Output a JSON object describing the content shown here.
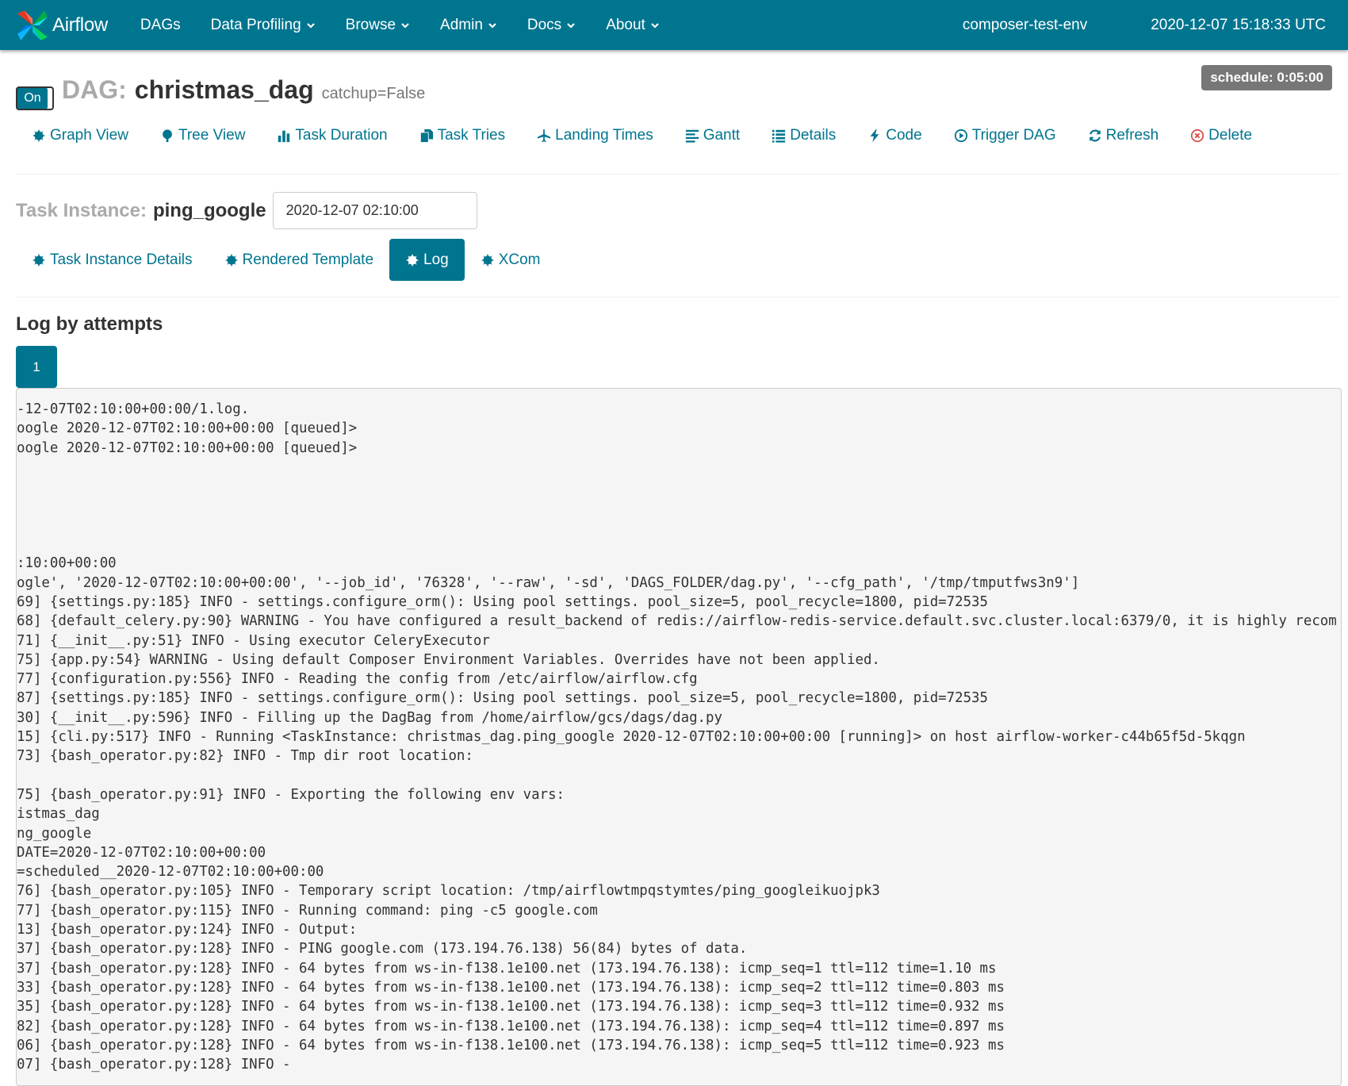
{
  "navbar": {
    "brand": "Airflow",
    "items": [
      {
        "label": "DAGs",
        "dropdown": false
      },
      {
        "label": "Data Profiling",
        "dropdown": true
      },
      {
        "label": "Browse",
        "dropdown": true
      },
      {
        "label": "Admin",
        "dropdown": true
      },
      {
        "label": "Docs",
        "dropdown": true
      },
      {
        "label": "About",
        "dropdown": true
      }
    ],
    "environment": "composer-test-env",
    "clock": "2020-12-07 15:18:33 UTC"
  },
  "dag": {
    "toggle_label": "On",
    "label": "DAG:",
    "name": "christmas_dag",
    "catchup": "catchup=False",
    "schedule": "schedule: 0:05:00"
  },
  "dag_nav": [
    {
      "label": "Graph View",
      "icon": "asterisk-icon"
    },
    {
      "label": "Tree View",
      "icon": "tree-icon"
    },
    {
      "label": "Task Duration",
      "icon": "bar-chart-icon"
    },
    {
      "label": "Task Tries",
      "icon": "duplicate-icon"
    },
    {
      "label": "Landing Times",
      "icon": "plane-icon"
    },
    {
      "label": "Gantt",
      "icon": "align-left-icon"
    },
    {
      "label": "Details",
      "icon": "list-icon"
    },
    {
      "label": "Code",
      "icon": "flash-icon"
    },
    {
      "label": "Trigger DAG",
      "icon": "play-circle-icon"
    },
    {
      "label": "Refresh",
      "icon": "refresh-icon"
    },
    {
      "label": "Delete",
      "icon": "remove-circle-icon"
    }
  ],
  "task_instance": {
    "label": "Task Instance:",
    "name": "ping_google",
    "execution_date": "2020-12-07 02:10:00"
  },
  "ti_tabs": [
    {
      "label": "Task Instance Details",
      "active": false
    },
    {
      "label": "Rendered Template",
      "active": false
    },
    {
      "label": "Log",
      "active": true
    },
    {
      "label": "XCom",
      "active": false
    }
  ],
  "log": {
    "title": "Log by attempts",
    "attempts": [
      "1"
    ],
    "lines": [
      "-12-07T02:10:00+00:00/1.log.",
      "oogle 2020-12-07T02:10:00+00:00 [queued]>",
      "oogle 2020-12-07T02:10:00+00:00 [queued]>",
      "",
      "",
      "",
      "",
      "",
      ":10:00+00:00",
      "ogle', '2020-12-07T02:10:00+00:00', '--job_id', '76328', '--raw', '-sd', 'DAGS_FOLDER/dag.py', '--cfg_path', '/tmp/tmputfws3n9']",
      "69] {settings.py:185} INFO - settings.configure_orm(): Using pool settings. pool_size=5, pool_recycle=1800, pid=72535",
      "68] {default_celery.py:90} WARNING - You have configured a result_backend of redis://airflow-redis-service.default.svc.cluster.local:6379/0, it is highly recom",
      "71] {__init__.py:51} INFO - Using executor CeleryExecutor",
      "75] {app.py:54} WARNING - Using default Composer Environment Variables. Overrides have not been applied.",
      "77] {configuration.py:556} INFO - Reading the config from /etc/airflow/airflow.cfg",
      "87] {settings.py:185} INFO - settings.configure_orm(): Using pool settings. pool_size=5, pool_recycle=1800, pid=72535",
      "30] {__init__.py:596} INFO - Filling up the DagBag from /home/airflow/gcs/dags/dag.py",
      "15] {cli.py:517} INFO - Running <TaskInstance: christmas_dag.ping_google 2020-12-07T02:10:00+00:00 [running]> on host airflow-worker-c44b65f5d-5kqgn",
      "73] {bash_operator.py:82} INFO - Tmp dir root location:",
      "",
      "75] {bash_operator.py:91} INFO - Exporting the following env vars:",
      "istmas_dag",
      "ng_google",
      "DATE=2020-12-07T02:10:00+00:00",
      "=scheduled__2020-12-07T02:10:00+00:00",
      "76] {bash_operator.py:105} INFO - Temporary script location: /tmp/airflowtmpqstymtes/ping_googleikuojpk3",
      "77] {bash_operator.py:115} INFO - Running command: ping -c5 google.com",
      "13] {bash_operator.py:124} INFO - Output:",
      "37] {bash_operator.py:128} INFO - PING google.com (173.194.76.138) 56(84) bytes of data.",
      "37] {bash_operator.py:128} INFO - 64 bytes from ws-in-f138.1e100.net (173.194.76.138): icmp_seq=1 ttl=112 time=1.10 ms",
      "33] {bash_operator.py:128} INFO - 64 bytes from ws-in-f138.1e100.net (173.194.76.138): icmp_seq=2 ttl=112 time=0.803 ms",
      "35] {bash_operator.py:128} INFO - 64 bytes from ws-in-f138.1e100.net (173.194.76.138): icmp_seq=3 ttl=112 time=0.932 ms",
      "82] {bash_operator.py:128} INFO - 64 bytes from ws-in-f138.1e100.net (173.194.76.138): icmp_seq=4 ttl=112 time=0.897 ms",
      "06] {bash_operator.py:128} INFO - 64 bytes from ws-in-f138.1e100.net (173.194.76.138): icmp_seq=5 ttl=112 time=0.923 ms",
      "07] {bash_operator.py:128} INFO -"
    ]
  },
  "colors": {
    "brand": "#00758f",
    "badge": "#777777",
    "danger": "#d9534f"
  }
}
